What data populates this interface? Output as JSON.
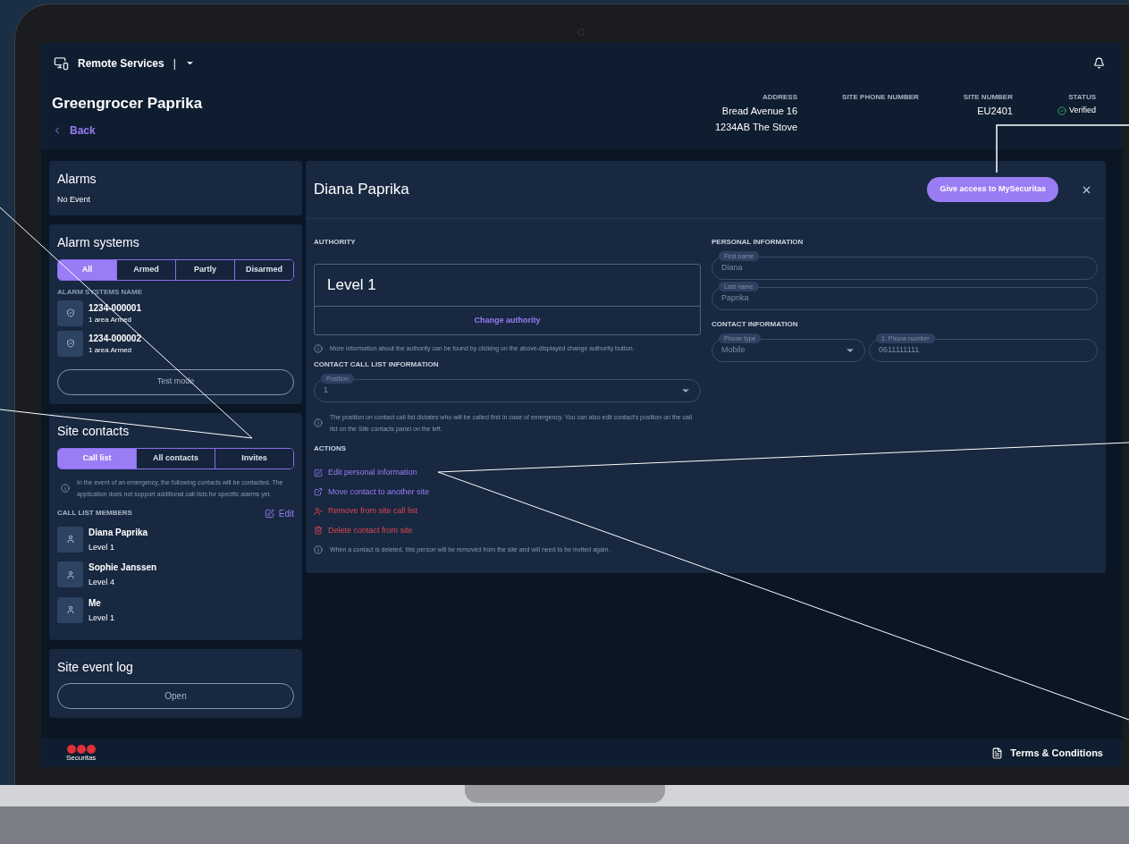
{
  "top_bar": {
    "app_name": "Remote Services",
    "separator": "|"
  },
  "site": {
    "title": "Greengrocer Paprika",
    "back": "Back",
    "info": [
      {
        "label": "ADDRESS",
        "lines": [
          "Bread Avenue 16",
          "1234AB The Stove"
        ]
      },
      {
        "label": "SITE PHONE NUMBER"
      },
      {
        "label": "SITE NUMBER",
        "lines": [
          "EU2401"
        ]
      },
      {
        "label": "STATUS",
        "status": "Verified"
      }
    ]
  },
  "alarms": {
    "title": "Alarms",
    "text": "No Event"
  },
  "alarm_systems": {
    "title": "Alarm systems",
    "filters": [
      {
        "label": "All",
        "selected": true
      },
      {
        "label": "Armed",
        "selected": false
      },
      {
        "label": "Partly",
        "selected": false
      },
      {
        "label": "Disarmed",
        "selected": false
      }
    ],
    "list_heading": "ALARM SYSTEMS NAME",
    "items": [
      {
        "name": "1234-000001",
        "status": "1 area Armed"
      },
      {
        "name": "1234-000002",
        "status": "1 area Armed"
      }
    ],
    "button": "Test mode"
  },
  "site_contacts": {
    "title": "Site contacts",
    "tabs": [
      {
        "label": "Call list",
        "selected": true
      },
      {
        "label": "All contacts",
        "selected": false
      },
      {
        "label": "Invites",
        "selected": false
      }
    ],
    "info": "In the event of an emergency, the following contacts will be contacted. The application does not support additional call lists for specific alarms yet.",
    "list_heading": "CALL LIST MEMBERS",
    "edit": "Edit",
    "members": [
      {
        "name": "Diana Paprika",
        "level": "Level 1"
      },
      {
        "name": "Sophie Janssen",
        "level": "Level 4"
      },
      {
        "name": "Me",
        "level": "Level 1"
      }
    ]
  },
  "event_log": {
    "title": "Site event log",
    "button": "Open"
  },
  "contact_panel": {
    "name": "Diana Paprika",
    "access_button": "Give access to MySecuritas",
    "authority": {
      "heading": "AUTHORITY",
      "level": "Level 1",
      "button": "Change authority",
      "info": "More information about the authority can be found by clicking on the above-displayed change authority button."
    },
    "call_list": {
      "heading": "CONTACT CALL LIST INFORMATION",
      "field": {
        "label": "Position",
        "value": "1"
      },
      "info": "The position on contact call list dictates who will be called first in case of emergency. You can also edit contact's position on the call list on the Site contacts panel on the left."
    },
    "actions": {
      "heading": "ACTIONS",
      "items": [
        {
          "label": "Edit personal information",
          "kind": "default"
        },
        {
          "label": "Move contact to another site",
          "kind": "default"
        },
        {
          "label": "Remove from site call list",
          "kind": "danger"
        },
        {
          "label": "Delete contact from site",
          "kind": "danger"
        }
      ],
      "info": "When a contact is deleted, this person will be removed from the site and will need to be invited again."
    },
    "personal": {
      "heading": "PERSONAL INFORMATION",
      "fields": [
        {
          "label": "First name",
          "value": "Diana"
        },
        {
          "label": "Last name",
          "value": "Paprika"
        }
      ]
    },
    "contact": {
      "heading": "CONTACT INFORMATION",
      "fields": [
        {
          "label": "Phone type",
          "value": "Mobile",
          "kind": "select"
        },
        {
          "label": "1. Phone number",
          "value": "0611111111",
          "kind": "text"
        }
      ]
    }
  },
  "footer": {
    "brand": "Securitas",
    "terms": "Terms & Conditions"
  }
}
